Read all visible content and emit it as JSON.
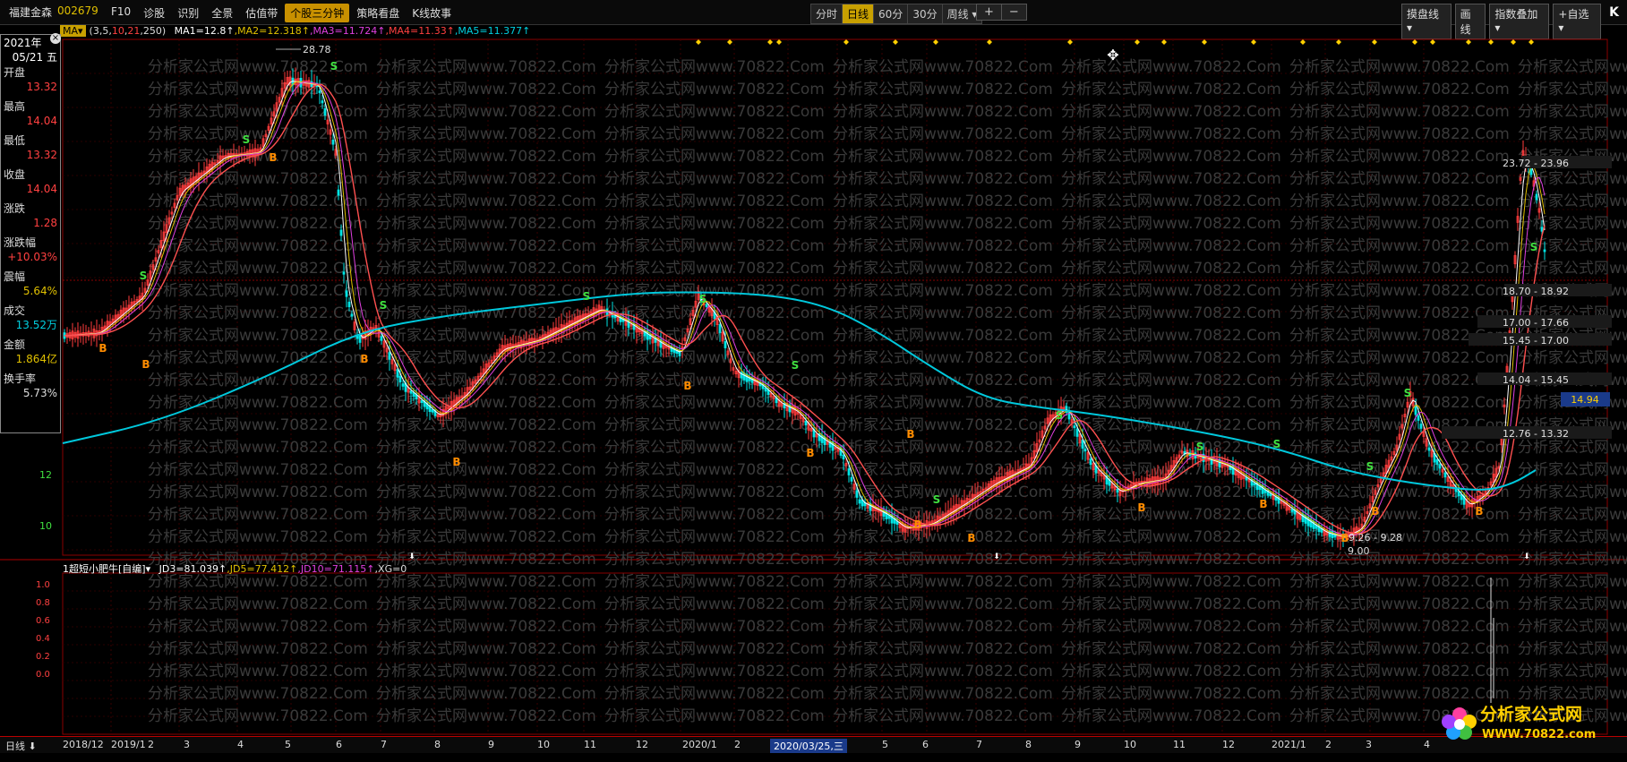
{
  "stock": {
    "name": "福建金森",
    "code": "002679"
  },
  "menu": [
    "F10",
    "诊股",
    "识别",
    "全景",
    "估值带",
    "个股三分钟",
    "策略看盘",
    "K线故事"
  ],
  "menu_active": "个股三分钟",
  "periods": [
    "分时",
    "日线",
    "60分",
    "30分",
    "周线 ▾"
  ],
  "period_active": "日线",
  "zoom": {
    "plus": "+",
    "minus": "−"
  },
  "right_tools": [
    "摸盘线 ▾",
    "画线",
    "指数叠加 ▾",
    "+自选 ▾"
  ],
  "right_k": "K",
  "ma_bar": {
    "btn": "MA▾",
    "params_prefix": "(3,5,",
    "p10": "10",
    "sep1": ",",
    "p21": "21",
    "sep2": ",250)",
    "ma1": "MA1=12.8↑",
    "ma2": ",MA2=12.318↑",
    "ma3": ",MA3=11.724↑",
    "ma4": ",MA4=11.33↑",
    "ma5": ",MA5=11.377↑"
  },
  "info": {
    "year": "2021年",
    "date": "05/21 五",
    "open_label": "开盘",
    "open": "13.32",
    "high_label": "最高",
    "high": "14.04",
    "low_label": "最低",
    "low": "13.32",
    "close_label": "收盘",
    "close": "14.04",
    "chg_label": "涨跌",
    "chg": "1.28",
    "pct_label": "涨跌幅",
    "pct": "+10.03%",
    "amp_label": "震幅",
    "amp": "5.64%",
    "vol_label": "成交",
    "vol": "13.52万",
    "amt_label": "金额",
    "amt": "1.864亿",
    "turn_label": "换手率",
    "turn": "5.73%"
  },
  "y_ticks": [
    "12",
    "10"
  ],
  "sub_y_ticks": [
    "1.0",
    "0.8",
    "0.6",
    "0.4",
    "0.2",
    "0.0"
  ],
  "price_marks": {
    "high": "28.78",
    "low": "9.00",
    "low_range": "9.26 - 9.28"
  },
  "ranges": [
    "23.72 - 23.96",
    "18.70 - 18.92",
    "17.00 - 17.66",
    "15.45 - 17.00",
    "14.04 - 15.45",
    "12.76 - 13.32"
  ],
  "current_price": "14.94",
  "sub_indicator": {
    "name": "1超短小肥牛[自编]▾",
    "jd3": "JD3=81.039↑",
    "jd5": ",JD5=77.412↑",
    "jd10": ",JD10=71.115↑",
    "xg": ",XG=0"
  },
  "date_axis": {
    "period_btn": "日线 ⬇",
    "labels": [
      "2018/12",
      "2019/1",
      "2",
      "3",
      "4",
      "5",
      "6",
      "7",
      "8",
      "9",
      "10",
      "11",
      "12",
      "2020/1",
      "2",
      "2020/03/25,三",
      "5",
      "6",
      "7",
      "8",
      "9",
      "10",
      "11",
      "12",
      "2021/1",
      "2",
      "3",
      "4"
    ]
  },
  "logo": {
    "text": "分析家公式网",
    "url": "WWW.70822.com"
  },
  "watermark": "分析家公式网www.70822.Com",
  "signals": {
    "b": "B",
    "s": "S"
  },
  "colors": {
    "up": "#ff3c3c",
    "down": "#00e5e5",
    "ma250": "#00c8dc",
    "ma_red": "#ff5050",
    "accent": "#c8a000"
  }
}
